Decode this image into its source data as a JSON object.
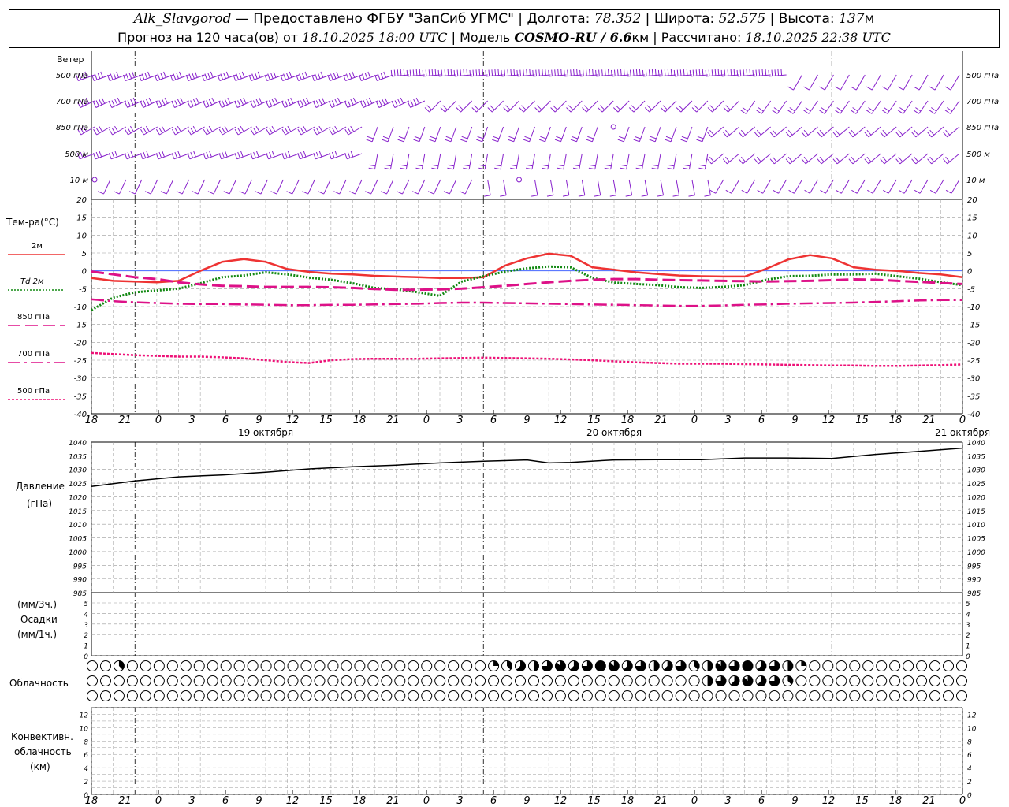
{
  "header": {
    "station": "Alk_Slavgorod",
    "dash": "—",
    "provider": "Предоставлено ФГБУ \"ЗапСиб УГМС\"",
    "lon_label": "Долгота:",
    "lon": "78.352",
    "lat_label": "Широта:",
    "lat": "52.575",
    "alt_label": "Высота:",
    "alt": "137",
    "alt_unit": "м",
    "forecast_prefix": "Прогноз на 120 часа(ов) от",
    "forecast_start": "18.10.2025 18:00 UTC",
    "model_label": "Модель",
    "model": "COSMO-RU / 6.6",
    "model_unit": "км",
    "calc_label": "Рассчитано:",
    "calc_time": "18.10.2025 22:38 UTC"
  },
  "colors": {
    "t2m": "#ee3333",
    "td2m": "#118811",
    "t850": "#dd1188",
    "t700": "#dd1188",
    "t500": "#ee1177",
    "wind": "#8822cc",
    "grid": "#999999",
    "pressure": "#000000"
  },
  "labels": {
    "wind": "Ветер",
    "wind_levels": [
      "500 гПа",
      "700 гПа",
      "850 гПа",
      "500 м",
      "10 м"
    ],
    "temp_title": "Тем-ра(°С)",
    "pressure_title": "Давление",
    "pressure_unit": "(гПа)",
    "precip_unit1": "(мм/3ч.)",
    "precip_title": "Осадки",
    "precip_unit2": "(мм/1ч.)",
    "cloud_title": "Облачность",
    "conv_title1": "Конвективн.",
    "conv_title2": "облачность",
    "conv_unit": "(км)"
  },
  "chart_data": [
    {
      "type": "line",
      "title": "Тем-ра(°С)",
      "x": [
        0,
        3,
        6,
        9,
        12,
        15,
        18,
        21,
        24,
        27,
        30,
        33,
        36,
        39,
        42,
        45,
        48,
        51,
        54,
        57,
        60,
        63,
        66,
        69,
        72,
        75,
        78,
        81,
        84,
        87,
        90,
        93,
        96,
        99,
        102,
        105,
        108,
        111,
        114,
        117,
        120
      ],
      "x_tick_labels": [
        "18",
        "21",
        "0",
        "3",
        "6",
        "9",
        "12",
        "15",
        "18",
        "21",
        "0",
        "3",
        "6",
        "9",
        "12",
        "15",
        "18",
        "21",
        "0",
        "3",
        "6",
        "9",
        "12",
        "15",
        "18",
        "21",
        "0"
      ],
      "day_labels": [
        "19 октября",
        "20 октября",
        "21 октября"
      ],
      "ylim": [
        -40,
        20
      ],
      "yticks": [
        -40,
        -35,
        -30,
        -25,
        -20,
        -15,
        -10,
        -5,
        0,
        5,
        10,
        15,
        20
      ],
      "legend_position": "left",
      "series": [
        {
          "name": "2м",
          "values": [
            -2,
            -2.8,
            -3,
            -3.2,
            -2.8,
            0,
            2.5,
            3.3,
            2.5,
            0.5,
            -0.3,
            -0.8,
            -1,
            -1.4,
            -1.6,
            -1.8,
            -2,
            -2,
            -1.8,
            1.5,
            3.5,
            4.8,
            4.2,
            1,
            0.3,
            -0.4,
            -0.9,
            -1.3,
            -1.5,
            -1.6,
            -1.6,
            0.6,
            3.2,
            4.4,
            3.5,
            1,
            0.3,
            0,
            -0.6,
            -1,
            -1.8
          ]
        },
        {
          "name": "Td 2м",
          "values": [
            -11,
            -7.5,
            -6,
            -5.5,
            -5,
            -3.5,
            -1.8,
            -1.3,
            -0.4,
            -1,
            -1.9,
            -2.5,
            -3.5,
            -4.8,
            -5.2,
            -6,
            -7,
            -3,
            -1.5,
            -0.2,
            0.7,
            1.2,
            1,
            -2,
            -3.3,
            -3.7,
            -4,
            -4.6,
            -4.8,
            -4.5,
            -4,
            -2.5,
            -1.5,
            -1.4,
            -1,
            -1,
            -0.8,
            -1.5,
            -2.2,
            -3.2,
            -4
          ]
        },
        {
          "name": "850 гПа",
          "values": [
            -0.2,
            -1,
            -1.8,
            -2.3,
            -3.2,
            -3.8,
            -4.2,
            -4.3,
            -4.5,
            -4.5,
            -4.5,
            -4.6,
            -4.8,
            -5.1,
            -5.3,
            -5.3,
            -5.2,
            -5,
            -4.6,
            -4.2,
            -3.7,
            -3.2,
            -2.8,
            -2.5,
            -2.3,
            -2.3,
            -2.5,
            -2.6,
            -2.7,
            -2.8,
            -2.9,
            -3,
            -2.9,
            -2.8,
            -2.6,
            -2.4,
            -2.5,
            -2.8,
            -3.1,
            -3.4,
            -3.7
          ]
        },
        {
          "name": "700 гПа",
          "values": [
            -8,
            -8.5,
            -8.8,
            -9,
            -9.2,
            -9.3,
            -9.3,
            -9.4,
            -9.5,
            -9.6,
            -9.6,
            -9.5,
            -9.5,
            -9.4,
            -9.3,
            -9.2,
            -9,
            -8.9,
            -8.9,
            -9,
            -9.1,
            -9.2,
            -9.3,
            -9.4,
            -9.5,
            -9.6,
            -9.7,
            -9.8,
            -9.8,
            -9.7,
            -9.5,
            -9.4,
            -9.2,
            -9.1,
            -9,
            -8.9,
            -8.7,
            -8.5,
            -8.3,
            -8.2,
            -8.2
          ]
        },
        {
          "name": "500 гПа",
          "values": [
            -23,
            -23.3,
            -23.6,
            -23.8,
            -24,
            -24,
            -24.2,
            -24.5,
            -25,
            -25.5,
            -25.8,
            -25,
            -24.7,
            -24.6,
            -24.6,
            -24.6,
            -24.5,
            -24.4,
            -24.3,
            -24.4,
            -24.5,
            -24.6,
            -24.8,
            -25,
            -25.3,
            -25.6,
            -25.8,
            -26,
            -26,
            -26,
            -26.1,
            -26.2,
            -26.3,
            -26.4,
            -26.5,
            -26.5,
            -26.6,
            -26.6,
            -26.5,
            -26.4,
            -26.2
          ]
        }
      ]
    },
    {
      "type": "line",
      "title": "Давление",
      "ylabel": "(гПа)",
      "x": [
        0,
        6,
        12,
        18,
        24,
        30,
        36,
        42,
        48,
        54,
        60,
        63,
        66,
        72,
        78,
        84,
        90,
        96,
        102,
        108,
        114,
        120
      ],
      "ylim": [
        985,
        1040
      ],
      "yticks": [
        985,
        990,
        995,
        1000,
        1005,
        1010,
        1015,
        1020,
        1025,
        1030,
        1035,
        1040
      ],
      "series": [
        {
          "name": "",
          "values": [
            1023.8,
            1025.8,
            1027.3,
            1028,
            1029,
            1030.2,
            1031,
            1031.6,
            1032.4,
            1033,
            1033.5,
            1032.4,
            1032.6,
            1033.5,
            1033.6,
            1033.6,
            1034.2,
            1034.2,
            1034,
            1035.5,
            1036.6,
            1037.8
          ]
        }
      ]
    },
    {
      "type": "bar",
      "title": "Осадки",
      "ylabel": "(мм/3ч.) (мм/1ч.)",
      "ylim": [
        0,
        5
      ],
      "yticks": [
        0,
        1,
        2,
        3,
        4,
        5
      ],
      "series": []
    },
    {
      "type": "table",
      "title": "Облачность",
      "rows": 3,
      "legend": "cloud cover per hour, 0=clear 8=overcast"
    },
    {
      "type": "bar",
      "title": "Конвективн. облачность",
      "ylabel": "(км)",
      "ylim": [
        0,
        13
      ],
      "yticks": [
        0,
        2,
        4,
        6,
        8,
        10,
        12
      ],
      "series": []
    }
  ]
}
